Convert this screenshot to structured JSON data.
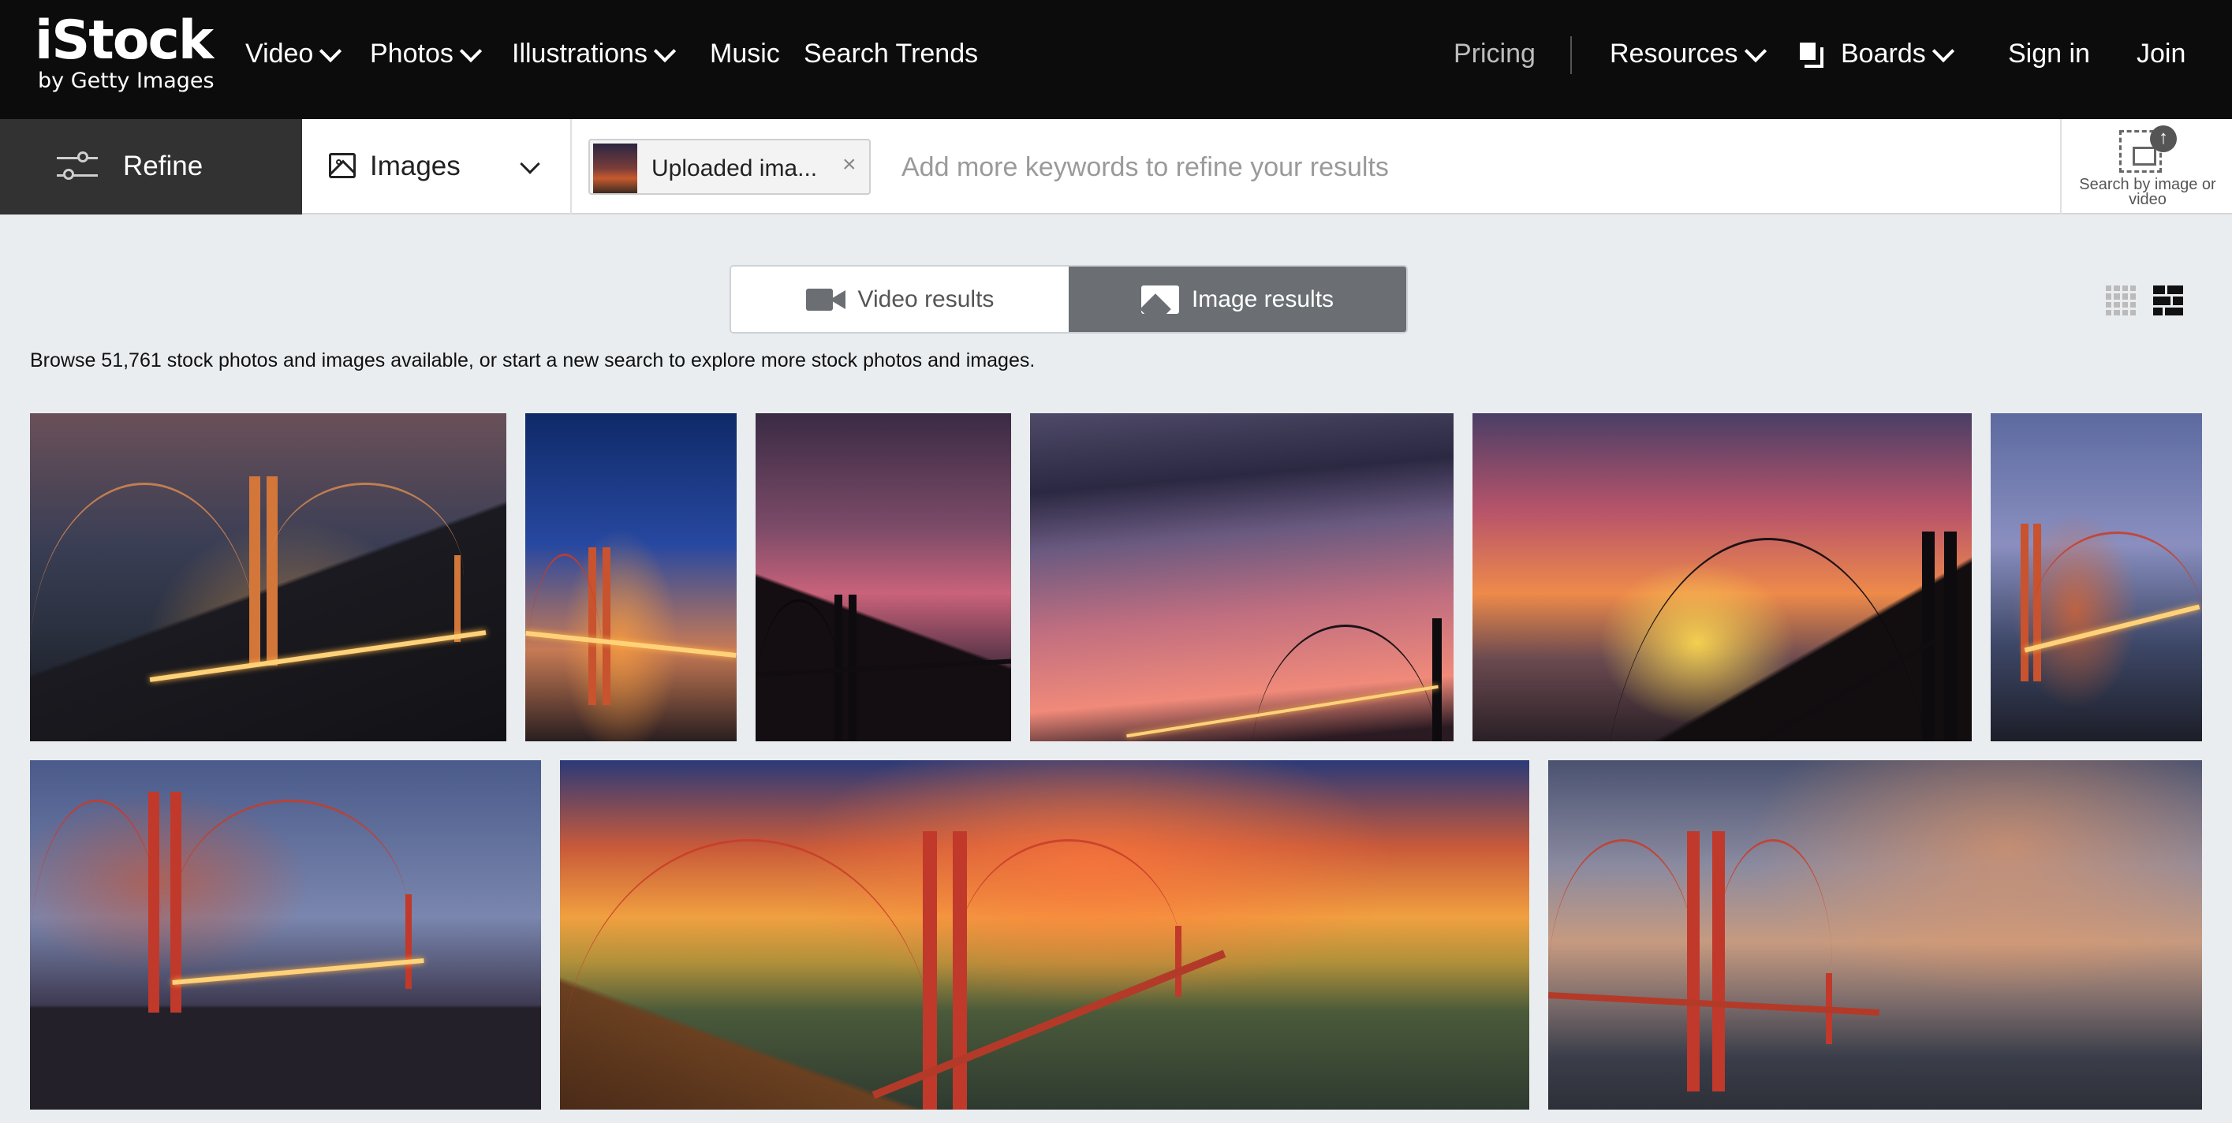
{
  "brand": {
    "logo_text": "iStock",
    "logo_sub": "by Getty Images"
  },
  "nav": {
    "items": [
      {
        "label": "Video",
        "dropdown": true
      },
      {
        "label": "Photos",
        "dropdown": true
      },
      {
        "label": "Illustrations",
        "dropdown": true
      },
      {
        "label": "Music",
        "dropdown": false
      },
      {
        "label": "Search Trends",
        "dropdown": false
      }
    ],
    "pricing": "Pricing",
    "resources": "Resources",
    "boards": "Boards",
    "sign_in": "Sign in",
    "join": "Join"
  },
  "search": {
    "refine_label": "Refine",
    "type_selected": "Images",
    "chip_label": "Uploaded ima...",
    "chip_close": "×",
    "keyword_placeholder": "Add more keywords to refine your results",
    "keyword_value": "",
    "search_by_image_label": "Search by image or video"
  },
  "results_toggle": {
    "video_label": "Video results",
    "image_label": "Image results",
    "active": "image"
  },
  "view_modes": {
    "active": "mosaic"
  },
  "browse_text": "Browse 51,761 stock photos and images available, or start a new search to explore more stock photos and images.",
  "colors": {
    "nav_bg": "#0c0c0c",
    "refine_bg": "#323232",
    "page_bg": "#eaedf0",
    "toggle_active": "#6b6f73"
  }
}
